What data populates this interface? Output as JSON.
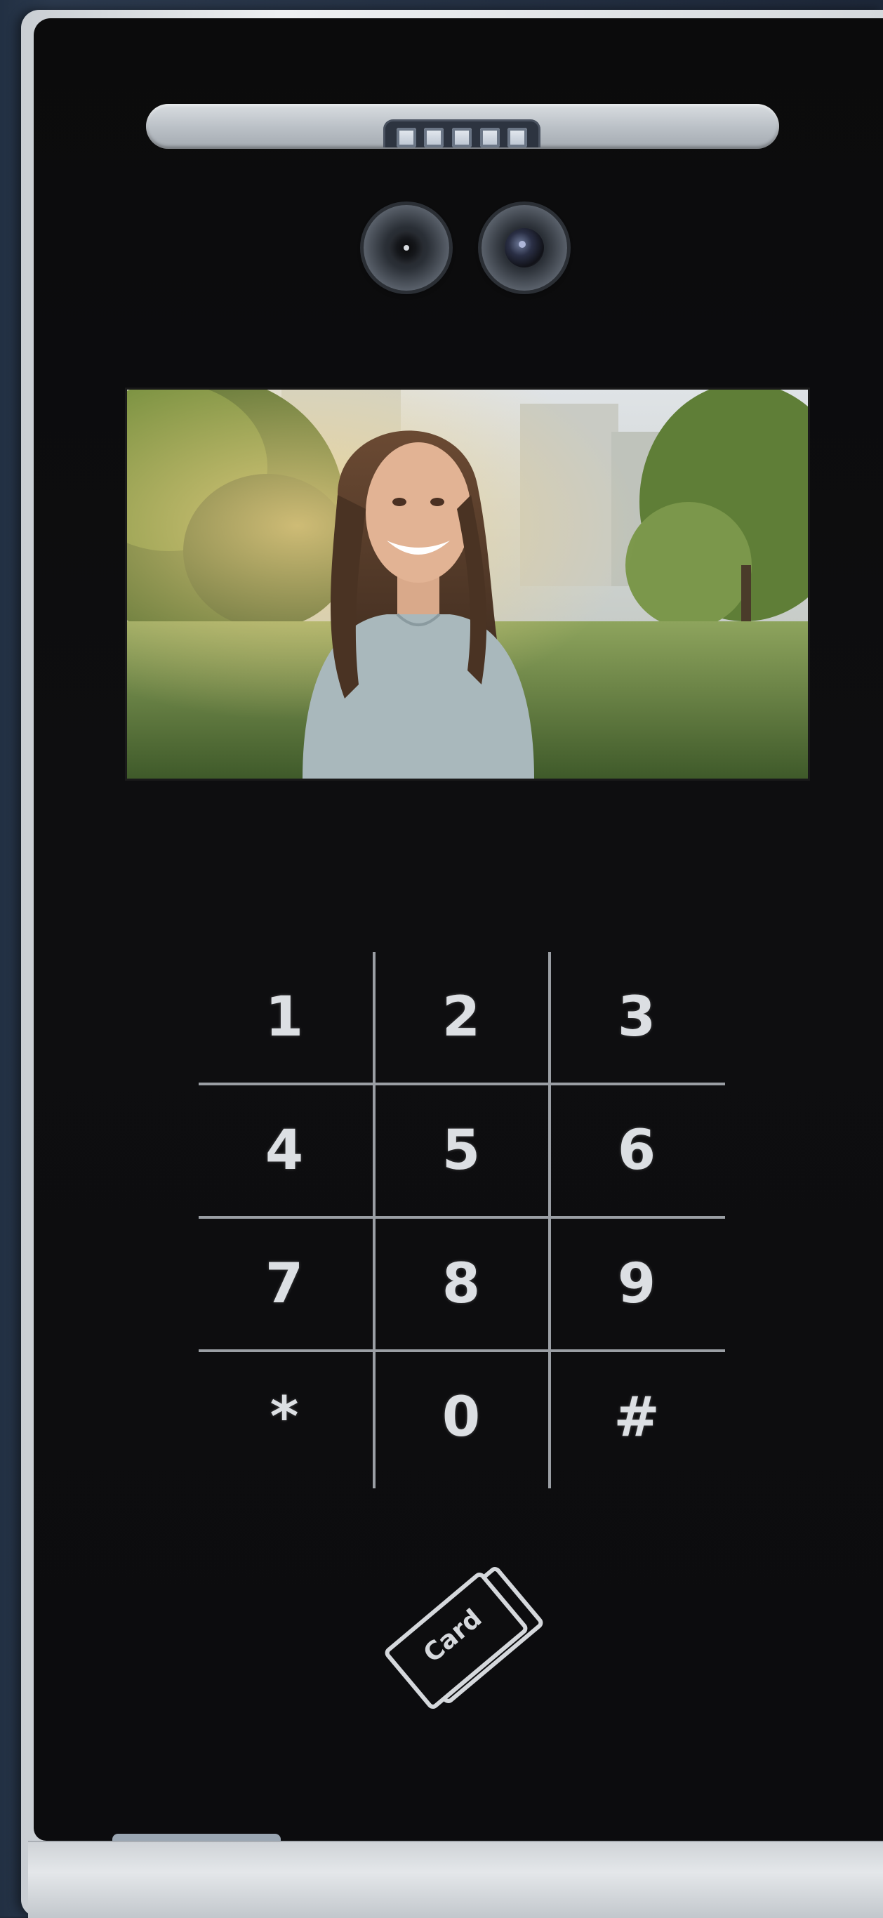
{
  "keypad": {
    "keys": [
      {
        "label": "1"
      },
      {
        "label": "2"
      },
      {
        "label": "3"
      },
      {
        "label": "4"
      },
      {
        "label": "5"
      },
      {
        "label": "6"
      },
      {
        "label": "7"
      },
      {
        "label": "8"
      },
      {
        "label": "9"
      },
      {
        "label": "*"
      },
      {
        "label": "0"
      },
      {
        "label": "#"
      }
    ]
  },
  "card_reader": {
    "label": "Card"
  },
  "colors": {
    "panel": "#0d0d0f",
    "frame": "#d9dde1",
    "key_text": "#dcdfe3",
    "grid": "#9a9ea4"
  },
  "icons": [
    "led-strip-icon",
    "camera-lens-icon",
    "card-icon"
  ]
}
